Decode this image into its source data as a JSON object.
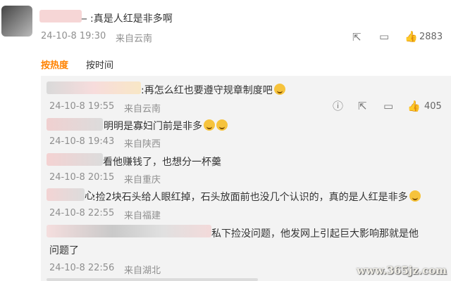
{
  "top_comment": {
    "username_suffix": "_",
    "text": ":真是人红是非多啊",
    "time": "24-10-8 19:30",
    "location": "来自云南",
    "like_count": "2883",
    "icons": [
      "share-icon",
      "comment-icon",
      "like-icon"
    ]
  },
  "tabs": {
    "hot": "按热度",
    "time": "按时间"
  },
  "replies": [
    {
      "text": ":再怎么红也要遵守规章制度吧",
      "time": "24-10-8 19:55",
      "location": "来自云南",
      "like_count": "405"
    },
    {
      "text": "明明是寡妇门前是非多",
      "time": "24-10-8 19:43",
      "location": "来自陕西"
    },
    {
      "text": "看他赚钱了，也想分一杯羹",
      "time": "24-10-8 20:15",
      "location": "来自重庆"
    },
    {
      "username_suffix": "心",
      "text": ":捡2块石头给人眼红掉，石头放面前也没几个认识的，真的是人红是非多",
      "time": "24-10-8 22:55",
      "location": "来自福建"
    },
    {
      "text_line1": "私下捡没问题，他发网上引起巨大影响那就是他",
      "text_line2": "问题了",
      "time": "24-10-8 22:56",
      "location": "来自湖北"
    }
  ],
  "watermark": "www.365jz.com",
  "colors": {
    "accent": "#ff8200",
    "meta": "#8f8f8f"
  }
}
